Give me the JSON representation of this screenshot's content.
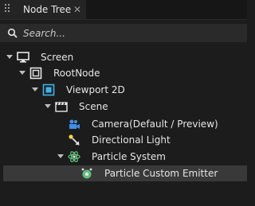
{
  "panel": {
    "tab_title": "Node Tree",
    "close_glyph": "✕"
  },
  "search": {
    "placeholder": "Search..."
  },
  "tree": {
    "items": [
      {
        "label": "Screen",
        "icon": "monitor-icon",
        "expanded": true
      },
      {
        "label": "RootNode",
        "icon": "root-node-icon",
        "expanded": true
      },
      {
        "label": "Viewport 2D",
        "icon": "viewport-icon",
        "expanded": true
      },
      {
        "label": "Scene",
        "icon": "scene-icon",
        "expanded": true
      },
      {
        "label": "Camera(Default / Preview)",
        "icon": "camera-icon"
      },
      {
        "label": "Directional Light",
        "icon": "light-icon"
      },
      {
        "label": "Particle System",
        "icon": "particle-system-icon",
        "expanded": true
      },
      {
        "label": "Particle Custom Emitter",
        "icon": "emitter-icon",
        "selected": true
      }
    ]
  },
  "colors": {
    "background": "#1c1c1c",
    "accent_blue": "#3fb3e6",
    "selected_row": "#393939",
    "light_yellow": "#f2d74a",
    "particle_green": "#5fbf7a"
  }
}
